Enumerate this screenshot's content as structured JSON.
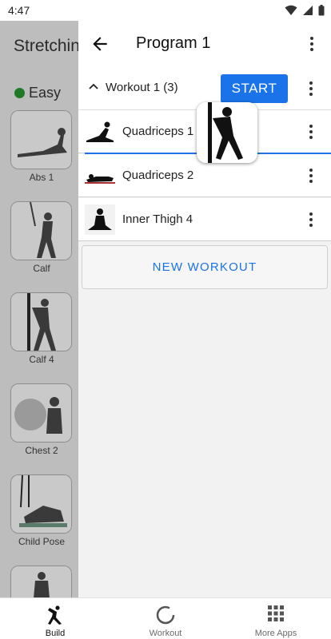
{
  "status_bar": {
    "time": "4:47"
  },
  "background": {
    "title": "Stretching",
    "level": "Easy",
    "level_color": "#1f7a28",
    "exercises": [
      {
        "label": "Abs 1"
      },
      {
        "label": "Calf"
      },
      {
        "label": "Calf 4"
      },
      {
        "label": "Chest 2"
      },
      {
        "label": "Child Pose"
      }
    ]
  },
  "header": {
    "title": "Program 1"
  },
  "workout": {
    "name": "Workout 1 (3)",
    "start_label": "START"
  },
  "exercises": [
    {
      "label": "Quadriceps 1"
    },
    {
      "label": "Quadriceps 2"
    },
    {
      "label": "Inner Thigh 4"
    }
  ],
  "new_workout_label": "NEW WORKOUT",
  "nav": {
    "items": [
      {
        "label": "Build",
        "icon": "stretch-figure-icon",
        "active": true
      },
      {
        "label": "Workout",
        "icon": "circle-progress-icon",
        "active": false
      },
      {
        "label": "More Apps",
        "icon": "grid-icon",
        "active": false
      }
    ]
  },
  "colors": {
    "accent": "#1a73e8",
    "scrim": "#bdbdbd"
  }
}
